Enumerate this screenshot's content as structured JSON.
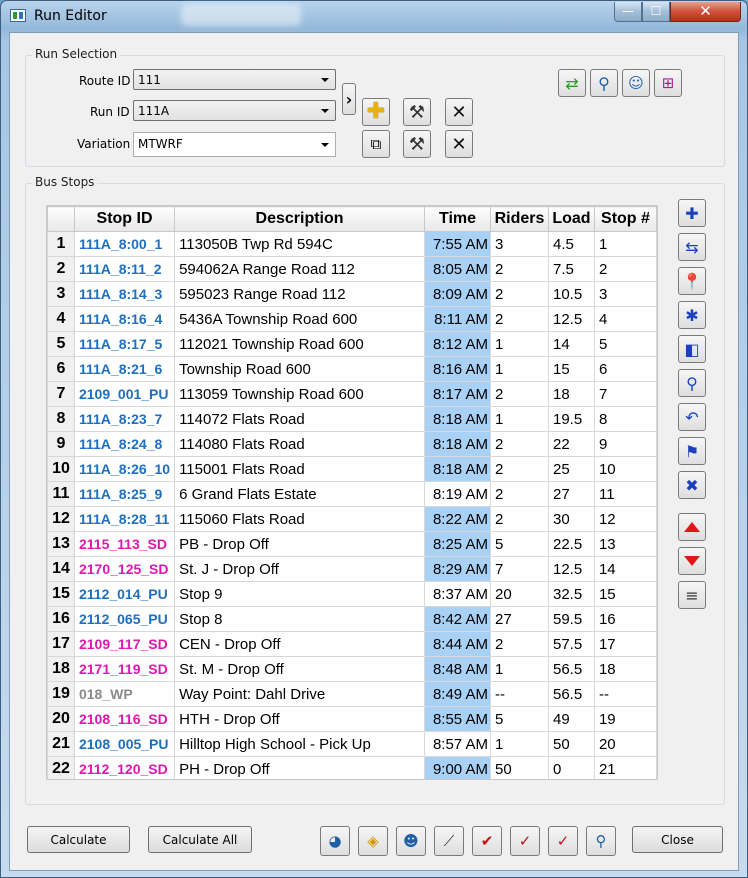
{
  "window": {
    "title": "Run Editor",
    "min": "—",
    "max": "☐",
    "close": "✕"
  },
  "run_selection": {
    "group_label": "Run Selection",
    "route_label": "Route ID",
    "route_value": "111",
    "run_label": "Run ID",
    "run_value": "111A",
    "variation_label": "Variation",
    "variation_value": "MTWRF"
  },
  "bus_stops": {
    "group_label": "Bus Stops",
    "columns": [
      "Stop ID",
      "Description",
      "Time",
      "Riders",
      "Load",
      "Stop #"
    ],
    "rows": [
      {
        "n": "1",
        "id": "111A_8:00_1",
        "desc": "113050B Twp Rd 594C",
        "time": "7:55 AM",
        "riders": "3",
        "load": "4.5",
        "stop": "1",
        "color": "blue",
        "hl": true
      },
      {
        "n": "2",
        "id": "111A_8:11_2",
        "desc": "594062A Range Road 112",
        "time": "8:05 AM",
        "riders": "2",
        "load": "7.5",
        "stop": "2",
        "color": "blue",
        "hl": true
      },
      {
        "n": "3",
        "id": "111A_8:14_3",
        "desc": "595023 Range Road 112",
        "time": "8:09 AM",
        "riders": "2",
        "load": "10.5",
        "stop": "3",
        "color": "blue",
        "hl": true
      },
      {
        "n": "4",
        "id": "111A_8:16_4",
        "desc": "5436A Township Road 600",
        "time": "8:11 AM",
        "riders": "2",
        "load": "12.5",
        "stop": "4",
        "color": "blue",
        "hl": true
      },
      {
        "n": "5",
        "id": "111A_8:17_5",
        "desc": "112021 Township Road 600",
        "time": "8:12 AM",
        "riders": "1",
        "load": "14",
        "stop": "5",
        "color": "blue",
        "hl": true
      },
      {
        "n": "6",
        "id": "111A_8:21_6",
        "desc": "Township Road 600",
        "time": "8:16 AM",
        "riders": "1",
        "load": "15",
        "stop": "6",
        "color": "blue",
        "hl": true
      },
      {
        "n": "7",
        "id": "2109_001_PU",
        "desc": "113059 Township Road 600",
        "time": "8:17 AM",
        "riders": "2",
        "load": "18",
        "stop": "7",
        "color": "blue",
        "hl": true
      },
      {
        "n": "8",
        "id": "111A_8:23_7",
        "desc": "114072 Flats Road",
        "time": "8:18 AM",
        "riders": "1",
        "load": "19.5",
        "stop": "8",
        "color": "blue",
        "hl": true
      },
      {
        "n": "9",
        "id": "111A_8:24_8",
        "desc": "114080 Flats Road",
        "time": "8:18 AM",
        "riders": "2",
        "load": "22",
        "stop": "9",
        "color": "blue",
        "hl": true
      },
      {
        "n": "10",
        "id": "111A_8:26_10",
        "desc": "115001 Flats Road",
        "time": "8:18 AM",
        "riders": "2",
        "load": "25",
        "stop": "10",
        "color": "blue",
        "hl": true
      },
      {
        "n": "11",
        "id": "111A_8:25_9",
        "desc": "6 Grand Flats Estate",
        "time": "8:19 AM",
        "riders": "2",
        "load": "27",
        "stop": "11",
        "color": "blue",
        "hl": false
      },
      {
        "n": "12",
        "id": "111A_8:28_11",
        "desc": "115060 Flats Road",
        "time": "8:22 AM",
        "riders": "2",
        "load": "30",
        "stop": "12",
        "color": "blue",
        "hl": true
      },
      {
        "n": "13",
        "id": "2115_113_SD",
        "desc": "PB - Drop Off",
        "time": "8:25 AM",
        "riders": "5",
        "load": "22.5",
        "stop": "13",
        "color": "pink",
        "hl": true
      },
      {
        "n": "14",
        "id": "2170_125_SD",
        "desc": "St. J - Drop Off",
        "time": "8:29 AM",
        "riders": "7",
        "load": "12.5",
        "stop": "14",
        "color": "pink",
        "hl": true
      },
      {
        "n": "15",
        "id": "2112_014_PU",
        "desc": "Stop 9",
        "time": "8:37 AM",
        "riders": "20",
        "load": "32.5",
        "stop": "15",
        "color": "blue",
        "hl": false
      },
      {
        "n": "16",
        "id": "2112_065_PU",
        "desc": "Stop 8",
        "time": "8:42 AM",
        "riders": "27",
        "load": "59.5",
        "stop": "16",
        "color": "blue",
        "hl": true
      },
      {
        "n": "17",
        "id": "2109_117_SD",
        "desc": "CEN - Drop Off",
        "time": "8:44 AM",
        "riders": "2",
        "load": "57.5",
        "stop": "17",
        "color": "pink",
        "hl": true
      },
      {
        "n": "18",
        "id": "2171_119_SD",
        "desc": "St. M -  Drop Off",
        "time": "8:48 AM",
        "riders": "1",
        "load": "56.5",
        "stop": "18",
        "color": "pink",
        "hl": true
      },
      {
        "n": "19",
        "id": "018_WP",
        "desc": "Way Point: Dahl Drive",
        "time": "8:49 AM",
        "riders": "--",
        "load": "56.5",
        "stop": "--",
        "color": "gray",
        "hl": true
      },
      {
        "n": "20",
        "id": "2108_116_SD",
        "desc": "HTH - Drop Off",
        "time": "8:55 AM",
        "riders": "5",
        "load": "49",
        "stop": "19",
        "color": "pink",
        "hl": true
      },
      {
        "n": "21",
        "id": "2108_005_PU",
        "desc": "Hilltop High School - Pick Up",
        "time": "8:57 AM",
        "riders": "1",
        "load": "50",
        "stop": "20",
        "color": "blue",
        "hl": false
      },
      {
        "n": "22",
        "id": "2112_120_SD",
        "desc": "PH - Drop Off",
        "time": "9:00 AM",
        "riders": "50",
        "load": "0",
        "stop": "21",
        "color": "pink",
        "hl": true
      }
    ]
  },
  "buttons": {
    "calculate": "Calculate",
    "calculate_all": "Calculate All",
    "close": "Close"
  },
  "colors": {
    "blue_stop": "#1e6fbf",
    "pink_stop": "#dd17b0",
    "waypoint": "#8a8a8a",
    "time_highlight": "#a9d1f5"
  }
}
